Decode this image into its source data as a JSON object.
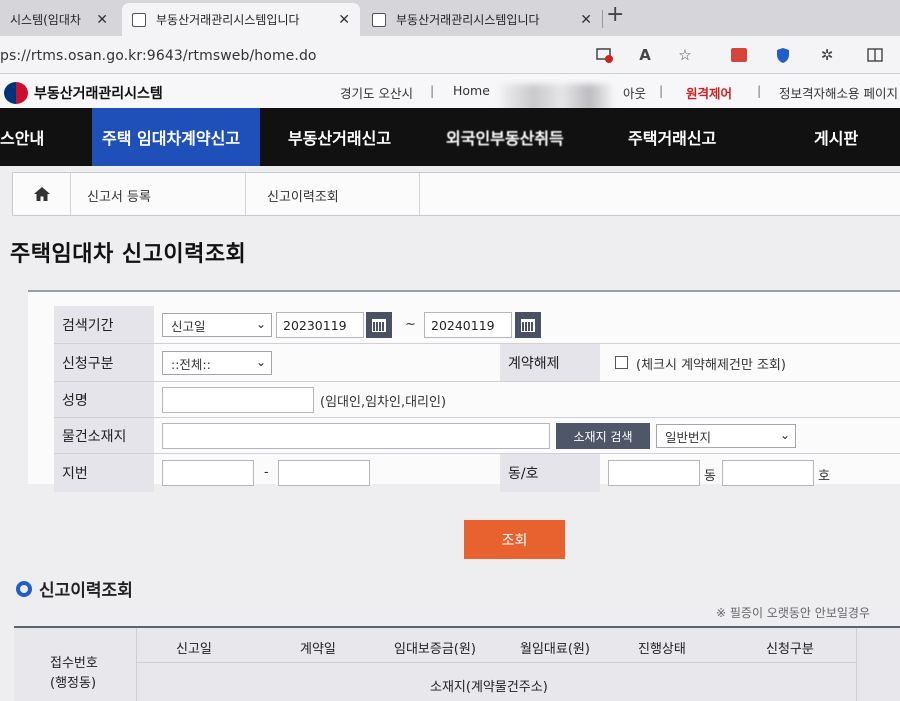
{
  "browser": {
    "tabs": [
      {
        "label": "시스템(임대차"
      },
      {
        "label": "부동산거래관리시스템입니다"
      },
      {
        "label": "부동산거래관리시스템입니다"
      }
    ],
    "close_glyph": "✕",
    "new_tab_glyph": "+",
    "url": "ps://rtms.osan.go.kr:9643/rtmsweb/home.do",
    "toolbar_icons": [
      "app-block-icon",
      "read-aloud-icon",
      "favorite-star-icon",
      "extension-red-icon",
      "shield-icon",
      "puzzle-icon",
      "split-screen-icon"
    ]
  },
  "site": {
    "logo_text": "부동산거래관리시스템",
    "region": "경기도 오산시",
    "sep": "|",
    "home_link": "Home",
    "logout_fragment": "아웃",
    "remote_control": "원격제어",
    "info_link": "정보격자해소용 페이지"
  },
  "nav": {
    "items": [
      {
        "label": "스안내"
      },
      {
        "label": "주택 임대차계약신고",
        "active": true
      },
      {
        "label": "부동산거래신고"
      },
      {
        "label": "외국인부동산취득"
      },
      {
        "label": "주택거래신고"
      },
      {
        "label": "게시판"
      }
    ]
  },
  "breadcrumb": {
    "items": [
      "신고서 등록",
      "신고이력조회"
    ]
  },
  "page": {
    "title": "주택임대차 신고이력조회"
  },
  "form": {
    "period_label": "검색기간",
    "period_type": "신고일",
    "date_from": "20230119",
    "tilde": "~",
    "date_to": "20240119",
    "apply_type_label": "신청구분",
    "apply_type_value": "::전체::",
    "cancel_label": "계약해제",
    "cancel_hint": "(체크시 계약해제건만 조회)",
    "name_label": "성명",
    "name_hint": "(임대인,임차인,대리인)",
    "address_label": "물건소재지",
    "address_search_button": "소재지 검색",
    "lot_type": "일반번지",
    "jibun_label": "지번",
    "jibun_dash": "-",
    "dongho_label": "동/호",
    "dong_unit": "동",
    "ho_unit": "호",
    "search_button": "조회",
    "dropdown_arrow": "⌄"
  },
  "results": {
    "section_title": "신고이력조회",
    "note": "※ 필증이 오랫동안 안보일경우",
    "columns": {
      "receipt_no": "접수번호",
      "admin_dong": "(행정동)",
      "report_date": "신고일",
      "contract_date": "계약일",
      "deposit": "임대보증금(원)",
      "monthly_rent": "월임대료(원)",
      "status": "진행상태",
      "apply_type": "신청구분",
      "address": "소재지(계약물건주소)"
    }
  }
}
